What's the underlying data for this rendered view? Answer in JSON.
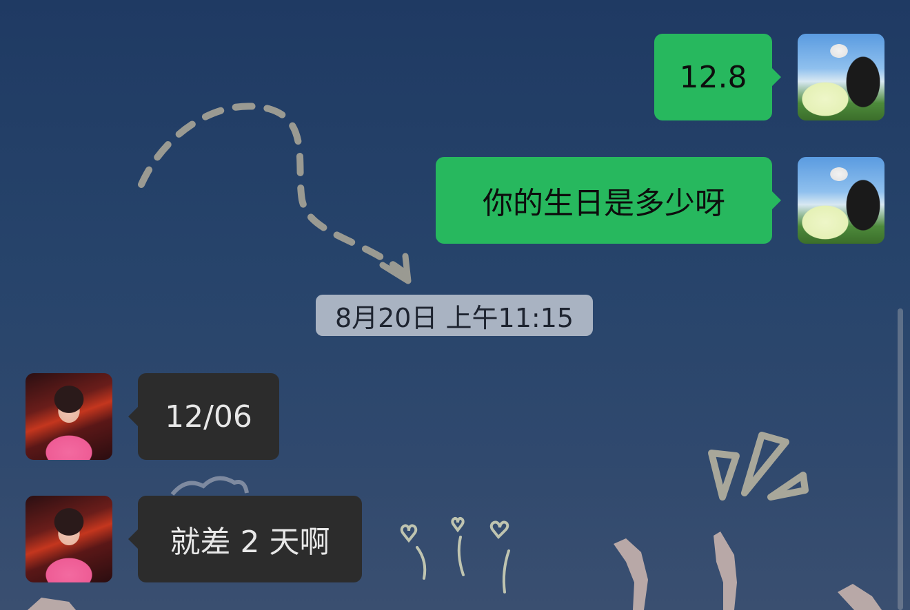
{
  "messages": [
    {
      "sender": "me",
      "text": "12.8"
    },
    {
      "sender": "me",
      "text": "你的生日是多少呀"
    },
    {
      "sender": "them",
      "text": "12/06"
    },
    {
      "sender": "them",
      "text": "就差 2 天啊"
    }
  ],
  "timestamp": "8月20日 上午11:15",
  "colors": {
    "my_bubble": "#27b85e",
    "their_bubble": "#2c2c2c",
    "timestamp_chip": "#a9b3c2",
    "background": "#27446b"
  }
}
